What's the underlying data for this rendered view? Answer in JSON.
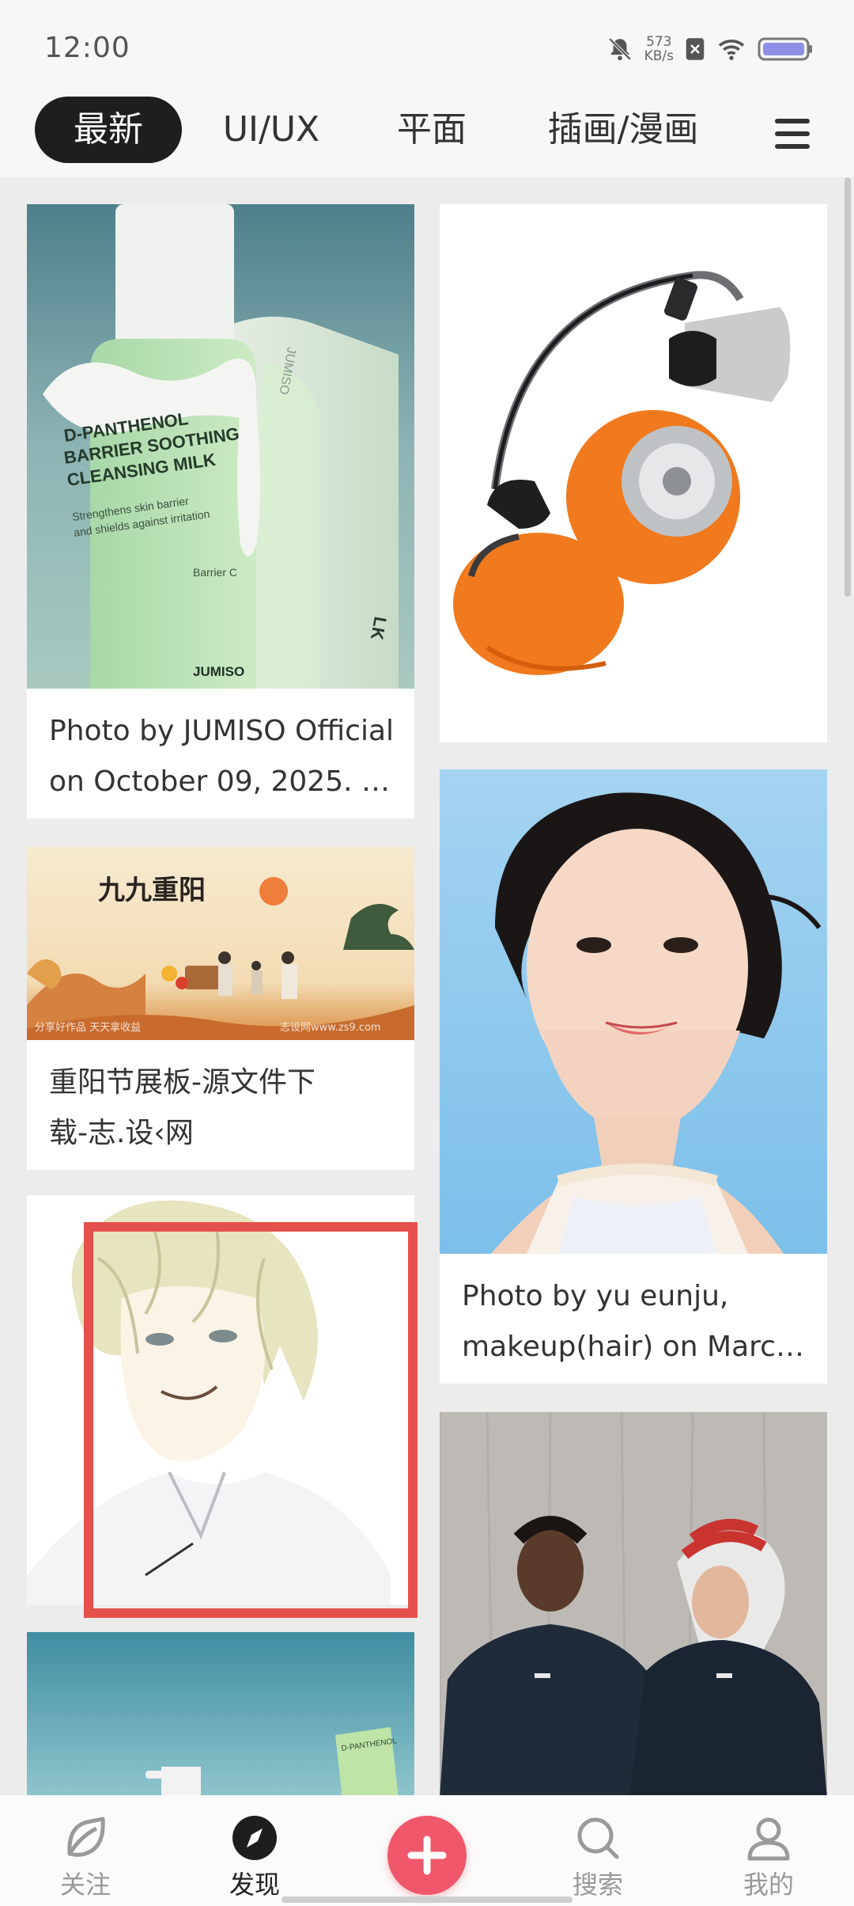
{
  "status_bar": {
    "time": "12:00",
    "net_speed_value": "573",
    "net_speed_unit": "KB/s",
    "icons": [
      "bell-muted-icon",
      "sim-x-icon",
      "wifi-icon",
      "battery-icon"
    ]
  },
  "tabs": [
    {
      "label": "最新",
      "active": true
    },
    {
      "label": "UI/UX",
      "active": false
    },
    {
      "label": "平面",
      "active": false
    },
    {
      "label": "插画/漫画",
      "active": false
    }
  ],
  "feed": {
    "left": [
      {
        "caption_line1": "Photo by JUMISO Official",
        "caption_line2": "on October 09, 2025. …",
        "image": "skincare-bottles-photo",
        "brand_text": "JUMISO",
        "product_text": "D-PANTHENOL BARRIER SOOTHING CLEANSING MILK"
      },
      {
        "caption_line1": "重阳节展板-源文件下",
        "caption_line2": "载-志.设‹网",
        "image": "chinese-festival-banner",
        "banner_title": "九九重阳"
      },
      {
        "image": "anime-character-illustration"
      },
      {
        "image": "skincare-product-photo"
      }
    ],
    "right": [
      {
        "image": "orange-headphones-photo"
      },
      {
        "caption_line1": "Photo by yu eunju,",
        "caption_line2": "makeup(hair) on March…",
        "image": "woman-portrait-photo"
      },
      {
        "image": "two-men-hoodies-photo"
      }
    ]
  },
  "bottom_nav": {
    "items": [
      {
        "label": "关注",
        "icon": "leaf-icon"
      },
      {
        "label": "发现",
        "icon": "compass-icon",
        "active": true
      },
      {
        "label": "",
        "icon": "add-icon"
      },
      {
        "label": "搜索",
        "icon": "search-icon"
      },
      {
        "label": "我的",
        "icon": "user-icon"
      }
    ]
  },
  "colors": {
    "accent": "#f0576a",
    "highlight": "#e6504c",
    "tab_active_bg": "#1e1e1e"
  }
}
